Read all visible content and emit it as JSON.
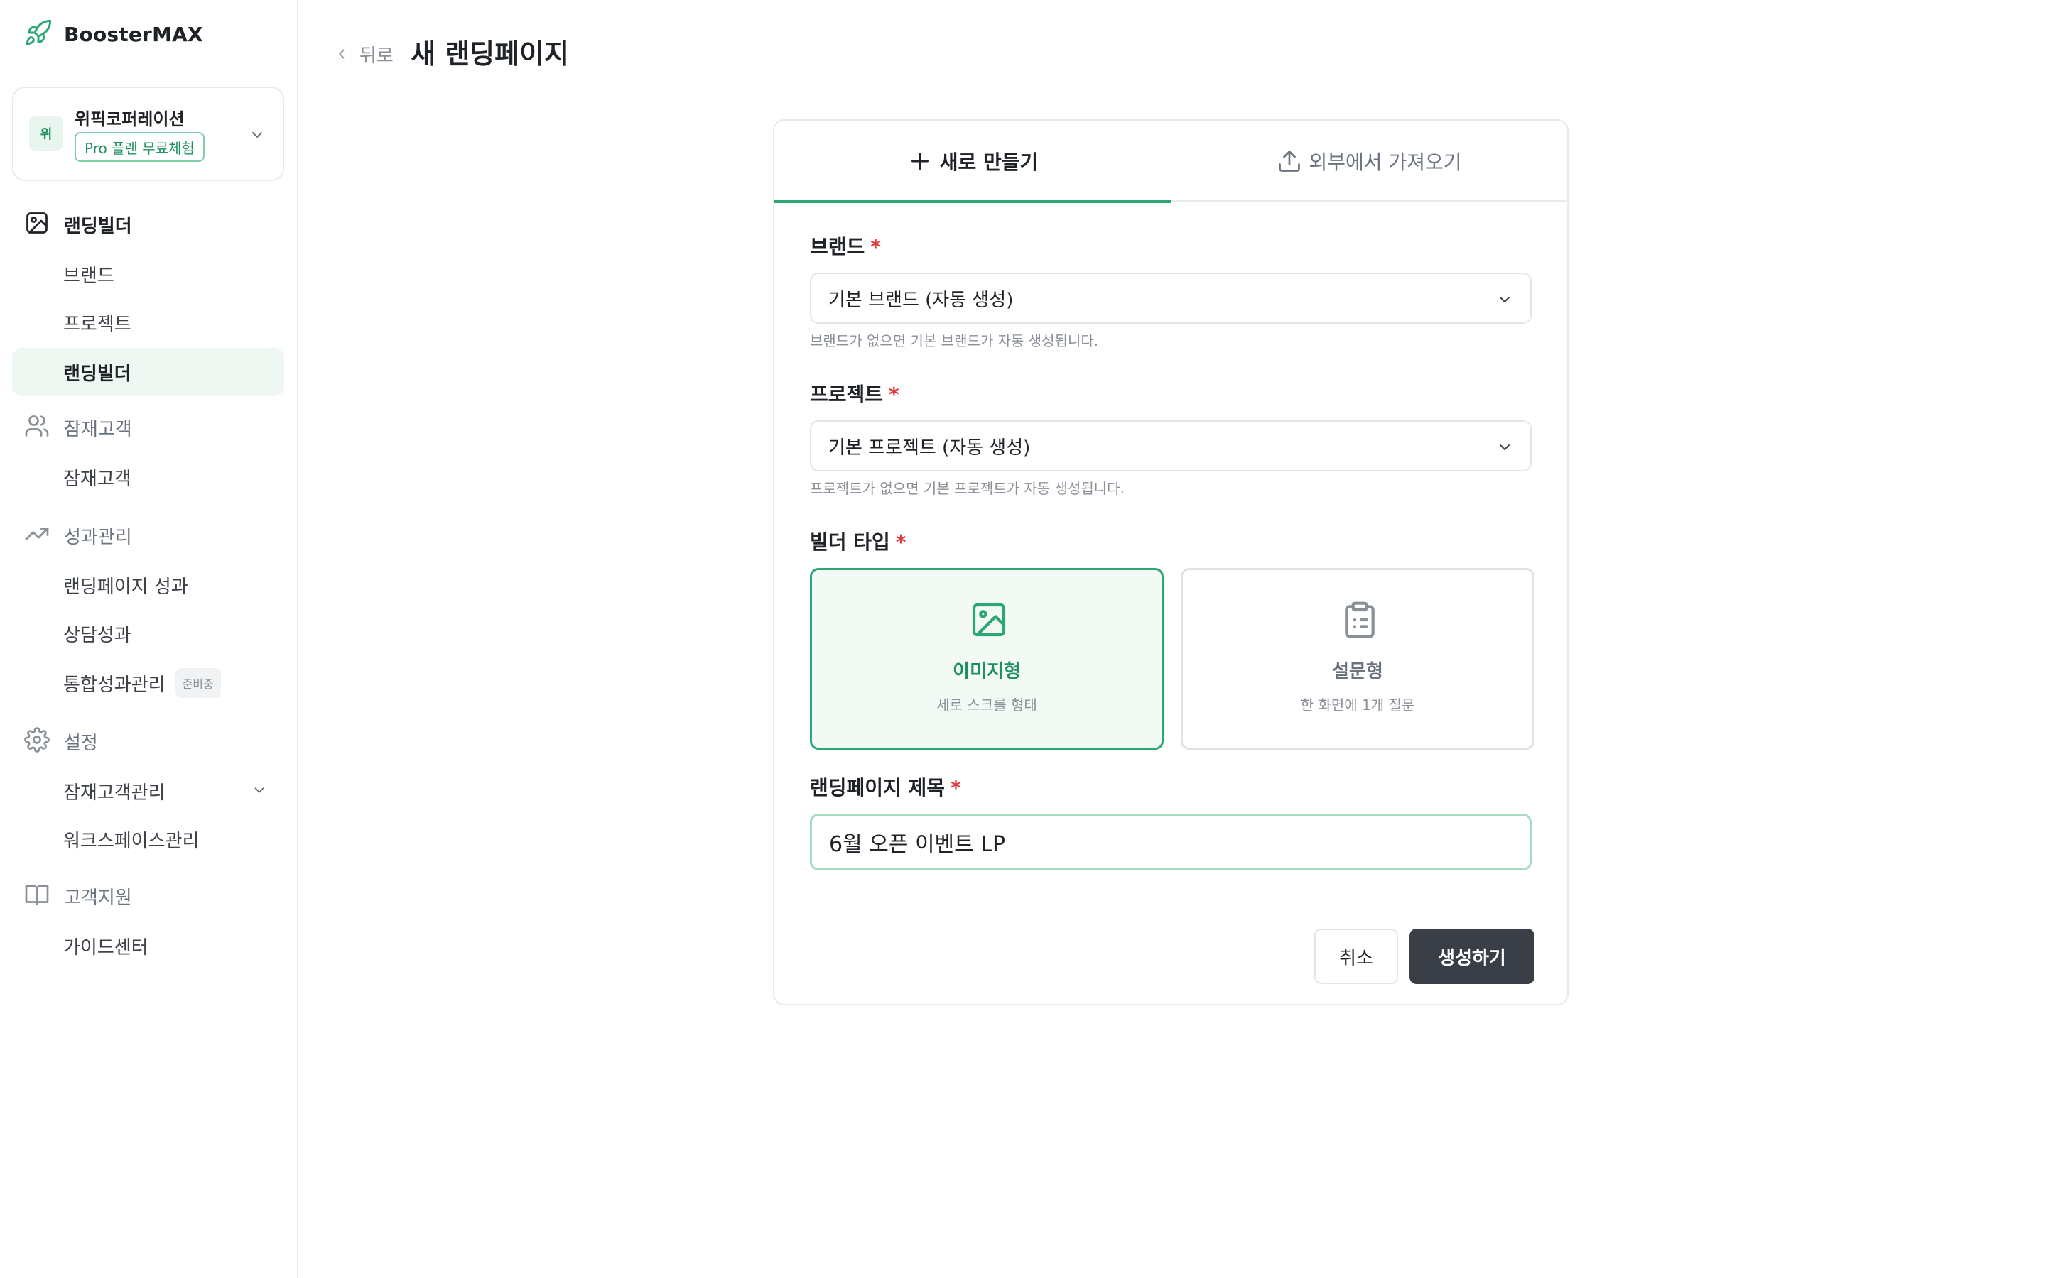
{
  "app": {
    "name": "BoosterMAX"
  },
  "workspace": {
    "avatar": "위",
    "name": "위픽코퍼레이션",
    "plan_badge": "Pro 플랜 무료체험"
  },
  "sidebar": {
    "sections": [
      {
        "label": "랜딩빌더",
        "icon": "image-frame-icon",
        "items": [
          "브랜드",
          "프로젝트",
          "랜딩빌더"
        ],
        "active_item": "랜딩빌더"
      },
      {
        "label": "잠재고객",
        "icon": "users-icon",
        "items": [
          "잠재고객"
        ]
      },
      {
        "label": "성과관리",
        "icon": "trending-up-icon",
        "items": [
          "랜딩페이지 성과",
          "상담성과",
          "통합성과관리"
        ],
        "badge": "준비중"
      },
      {
        "label": "설정",
        "icon": "gear-icon",
        "items": [
          "잠재고객관리",
          "워크스페이스관리"
        ]
      },
      {
        "label": "고객지원",
        "icon": "book-icon",
        "items": [
          "가이드센터"
        ]
      }
    ]
  },
  "header": {
    "back_label": "뒤로",
    "title": "새 랜딩페이지"
  },
  "tabs": {
    "create": "새로 만들기",
    "import": "외부에서 가져오기"
  },
  "form": {
    "brand": {
      "label": "브랜드",
      "value": "기본 브랜드 (자동 생성)",
      "hint": "브랜드가 없으면 기본 브랜드가 자동 생성됩니다."
    },
    "project": {
      "label": "프로젝트",
      "value": "기본 프로젝트 (자동 생성)",
      "hint": "프로젝트가 없으면 기본 프로젝트가 자동 생성됩니다."
    },
    "builder_type": {
      "label": "빌더 타입",
      "options": [
        {
          "title": "이미지형",
          "desc": "세로 스크롤 형태",
          "icon": "image-icon",
          "selected": true
        },
        {
          "title": "설문형",
          "desc": "한 화면에 1개 질문",
          "icon": "clipboard-icon",
          "selected": false
        }
      ]
    },
    "title": {
      "label": "랜딩페이지 제목",
      "value": "6월 오픈 이벤트 LP"
    },
    "required_mark": "*"
  },
  "actions": {
    "cancel": "취소",
    "create": "생성하기"
  },
  "colors": {
    "accent": "#2aa772",
    "accent_text": "#1f8f5f",
    "primary_button": "#3a3f47",
    "required": "#e0393e"
  }
}
